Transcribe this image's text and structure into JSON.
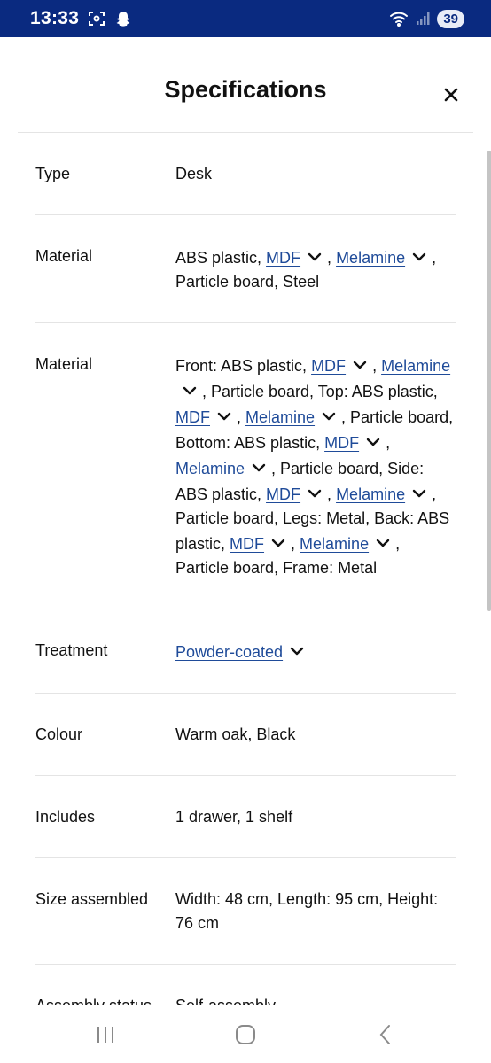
{
  "status_bar": {
    "time": "13:33",
    "battery": "39",
    "colors": {
      "background": "#0a2a80"
    }
  },
  "header": {
    "title": "Specifications"
  },
  "specs": [
    {
      "label": "Type",
      "value": [
        {
          "t": "Desk"
        }
      ]
    },
    {
      "label": "Material",
      "value": [
        {
          "t": "ABS plastic, "
        },
        {
          "t": "MDF",
          "link": true
        },
        {
          "t": ", "
        },
        {
          "t": "Melamine",
          "link": true
        },
        {
          "t": ", Particle board, Steel"
        }
      ]
    },
    {
      "label": "Material",
      "value": [
        {
          "t": "Front: ABS plastic, "
        },
        {
          "t": "MDF",
          "link": true
        },
        {
          "t": ", "
        },
        {
          "t": "Melamine",
          "link": true
        },
        {
          "t": ", Particle board, Top: ABS plastic, "
        },
        {
          "t": "MDF",
          "link": true
        },
        {
          "t": ", "
        },
        {
          "t": "Melamine",
          "link": true
        },
        {
          "t": ", Particle board, Bottom: ABS plastic, "
        },
        {
          "t": "MDF",
          "link": true
        },
        {
          "t": ", "
        },
        {
          "t": "Melamine",
          "link": true
        },
        {
          "t": ", Particle board, Side: ABS plastic, "
        },
        {
          "t": "MDF",
          "link": true
        },
        {
          "t": ", "
        },
        {
          "t": "Melamine",
          "link": true
        },
        {
          "t": ", Particle board, Legs: Metal, Back: ABS plastic, "
        },
        {
          "t": "MDF",
          "link": true
        },
        {
          "t": ", "
        },
        {
          "t": "Melamine",
          "link": true
        },
        {
          "t": ", Particle board, Frame: Metal"
        }
      ]
    },
    {
      "label": "Treatment",
      "value": [
        {
          "t": "Powder-coated",
          "link": true
        }
      ]
    },
    {
      "label": "Colour",
      "value": [
        {
          "t": "Warm oak, Black"
        }
      ]
    },
    {
      "label": "Includes",
      "value": [
        {
          "t": "1 drawer, 1 shelf"
        }
      ]
    },
    {
      "label": "Size assembled",
      "value": [
        {
          "t": "Width: 48 cm, Length: 95 cm, Height: 76 cm"
        }
      ]
    },
    {
      "label": "Assembly status",
      "value": [
        {
          "t": "Self-assembly"
        }
      ]
    }
  ],
  "icons": {
    "close": "close-icon",
    "chevron": "chevron-down-icon",
    "nav_recents": "recents-icon",
    "nav_home": "home-icon",
    "nav_back": "back-icon"
  },
  "colors": {
    "link": "#1f4b99",
    "divider": "#e4e4e4",
    "text": "#111111"
  }
}
